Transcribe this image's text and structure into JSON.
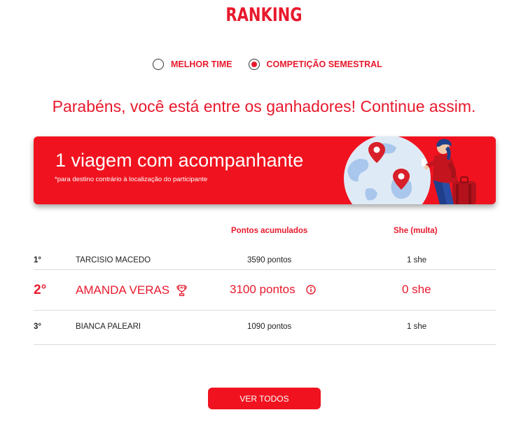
{
  "page": {
    "title": "RANKING"
  },
  "tabs": {
    "options": [
      {
        "label": "MELHOR TIME",
        "selected": false
      },
      {
        "label": "COMPETIÇÃO SEMESTRAL",
        "selected": true
      }
    ]
  },
  "message": "Parabéns, você está entre os ganhadores! Continue assim.",
  "banner": {
    "title": "1 viagem com acompanhante",
    "subtitle": "*para destino contrário à localização do participante",
    "illustration_icon": "globe-traveler-illustration"
  },
  "ranking": {
    "headers": {
      "points": "Pontos acumulados",
      "she": "She (multa)"
    },
    "rows": [
      {
        "position": "1°",
        "name": "TARCISIO MACEDO",
        "points": "3590 pontos",
        "she": "1 she"
      },
      {
        "position": "2°",
        "name": "AMANDA VERAS",
        "points": "3100 pontos",
        "she": "0 she",
        "icons": [
          "trophy-icon",
          "info-icon"
        ]
      },
      {
        "position": "3°",
        "name": "BIANCA PALEARI",
        "points": "1090 pontos",
        "she": "1 she"
      }
    ]
  },
  "actions": {
    "see_all": "VER TODOS"
  },
  "colors": {
    "accent": "#e8192c",
    "banner": "#f0131f",
    "divider": "#dcdcdc"
  }
}
